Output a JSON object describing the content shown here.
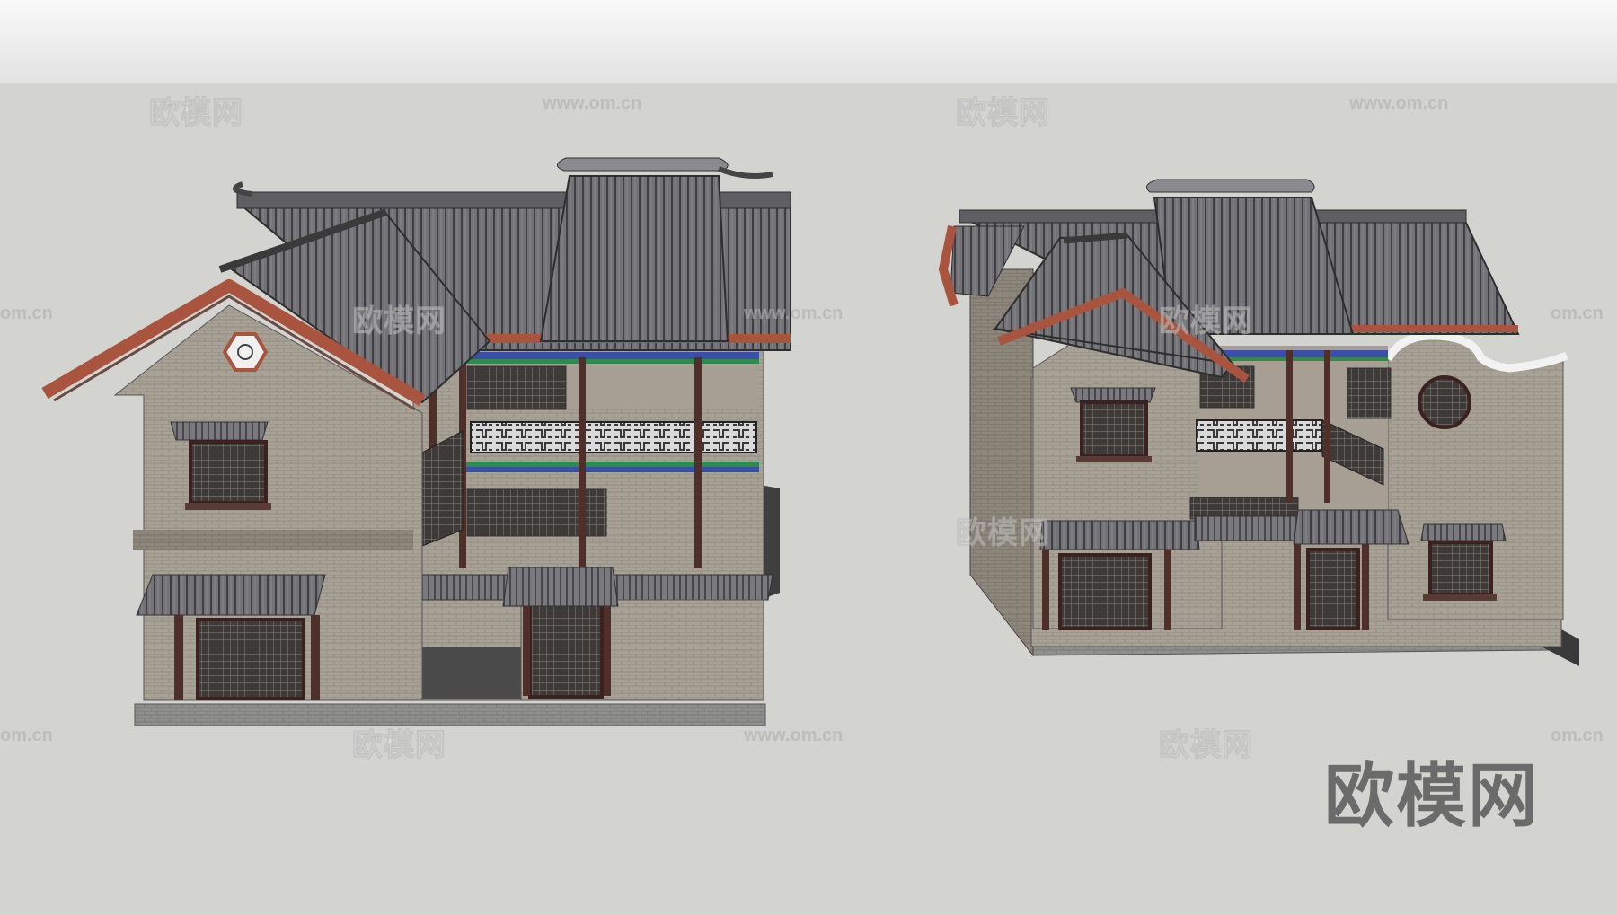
{
  "watermarks": {
    "cn_text": "欧模网",
    "url_text": "www.om.cn",
    "partial_url_text": "om.cn"
  },
  "brand_logo_text": "欧模网",
  "colors": {
    "sky": "#f2f2f2",
    "ground": "#d3d3cf",
    "roof_tile": "#6e6e72",
    "brick_wall": "#a59e93",
    "timber_red": "#a8543e",
    "dark_column": "#4e2f2a",
    "bracket_blue": "#3a4fa8",
    "bracket_green": "#2f8a4c",
    "paving": "#8e8e8c"
  }
}
